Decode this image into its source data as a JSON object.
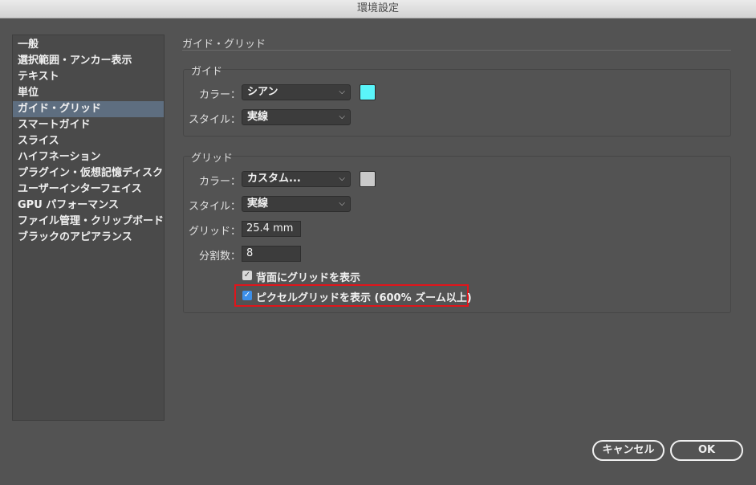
{
  "window": {
    "title": "環境設定"
  },
  "sidebar": {
    "items": [
      {
        "label": "一般"
      },
      {
        "label": "選択範囲・アンカー表示"
      },
      {
        "label": "テキスト"
      },
      {
        "label": "単位"
      },
      {
        "label": "ガイド・グリッド",
        "selected": true
      },
      {
        "label": "スマートガイド"
      },
      {
        "label": "スライス"
      },
      {
        "label": "ハイフネーション"
      },
      {
        "label": "プラグイン・仮想記憶ディスク"
      },
      {
        "label": "ユーザーインターフェイス"
      },
      {
        "label": "GPU パフォーマンス"
      },
      {
        "label": "ファイル管理・クリップボード"
      },
      {
        "label": "ブラックのアピアランス"
      }
    ]
  },
  "main": {
    "section_title": "ガイド・グリッド",
    "guide": {
      "group_label": "ガイド",
      "color_label": "カラー：",
      "color_value": "シアン",
      "color_swatch": "#5af5fa",
      "style_label": "スタイル：",
      "style_value": "実線"
    },
    "grid": {
      "group_label": "グリッド",
      "color_label": "カラー：",
      "color_value": "カスタム...",
      "color_swatch": "#cacaca",
      "style_label": "スタイル：",
      "style_value": "実線",
      "spacing_label": "グリッド：",
      "spacing_value": "25.4 mm",
      "subdiv_label": "分割数：",
      "subdiv_value": "8",
      "grids_in_back_label": "背面にグリッドを表示",
      "grids_in_back_checked": true,
      "pixel_grid_label": "ピクセルグリッドを表示 (600% ズーム以上)",
      "pixel_grid_checked": true
    }
  },
  "footer": {
    "cancel_label": "キャンセル",
    "ok_label": "OK"
  },
  "colors": {
    "background": "#535353",
    "selected_item": "#5e6e80",
    "highlight": "#e0151b",
    "checkbox_accent": "#3d8fe8"
  }
}
